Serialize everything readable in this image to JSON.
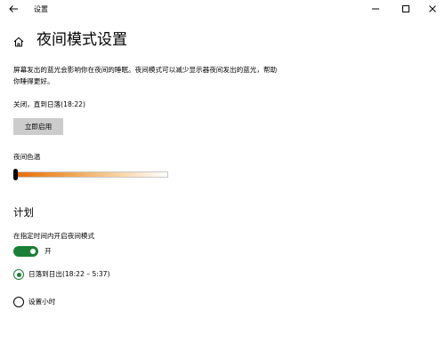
{
  "window": {
    "title": "设置"
  },
  "header": {
    "title": "夜间模式设置"
  },
  "main": {
    "description": "屏幕发出的蓝光会影响你在夜间的睡眠。夜间模式可以减少显示器夜间发出的蓝光，帮助你睡得更好。",
    "status": "关闭，直到日落(18:22)",
    "enable_button_label": "立即启用",
    "color_temp_label": "夜间色温",
    "color_temp_level": 0.0
  },
  "schedule": {
    "section_title": "计划",
    "toggle_label": "在指定时间内开启夜间模式",
    "toggle_state_label": "开",
    "toggle_on": true,
    "options": [
      {
        "label": "日落到日出(18:22 – 5:37)",
        "selected": true
      },
      {
        "label": "设置小时",
        "selected": false
      }
    ]
  },
  "colors": {
    "accent": "#1a7f37",
    "button_bg": "#cccccc"
  },
  "icons": {
    "back": "back-arrow-icon",
    "home": "home-icon",
    "minimize": "minimize-icon",
    "maximize": "maximize-icon",
    "close": "close-icon"
  }
}
